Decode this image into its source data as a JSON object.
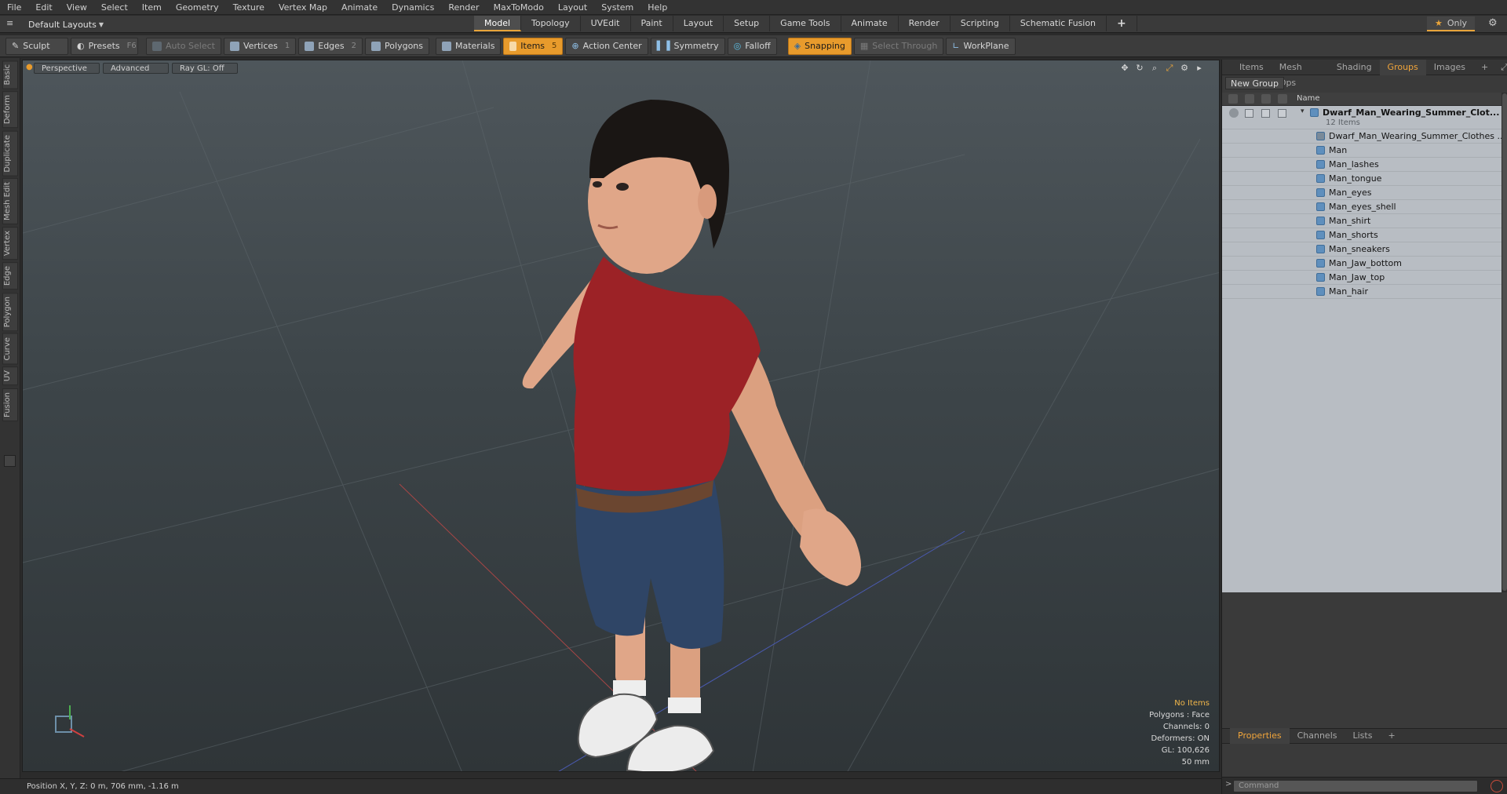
{
  "menu": [
    "File",
    "Edit",
    "View",
    "Select",
    "Item",
    "Geometry",
    "Texture",
    "Vertex Map",
    "Animate",
    "Dynamics",
    "Render",
    "MaxToModo",
    "Layout",
    "System",
    "Help"
  ],
  "layout": {
    "preset_label": "Default Layouts",
    "tabs": [
      "Model",
      "Topology",
      "UVEdit",
      "Paint",
      "Layout",
      "Setup",
      "Game Tools",
      "Animate",
      "Render",
      "Scripting",
      "Schematic Fusion"
    ],
    "active_tab": "Model",
    "add_tab": "+",
    "only_label": "Only"
  },
  "toolbar": {
    "sculpt": "Sculpt",
    "presets": "Presets",
    "presets_key": "F6",
    "auto_select": "Auto Select",
    "vertices": "Vertices",
    "vertices_count": "1",
    "edges": "Edges",
    "edges_count": "2",
    "polygons": "Polygons",
    "materials": "Materials",
    "items": "Items",
    "items_count": "5",
    "action_center": "Action Center",
    "symmetry": "Symmetry",
    "falloff": "Falloff",
    "snapping": "Snapping",
    "select_through": "Select Through",
    "workplane": "WorkPlane"
  },
  "left_tabs": [
    "Basic",
    "Deform",
    "Duplicate",
    "Mesh Edit",
    "Vertex",
    "Edge",
    "Polygon",
    "Curve",
    "UV",
    "Fusion"
  ],
  "viewport": {
    "view_mode": "Perspective",
    "shading": "Advanced",
    "raygl": "Ray GL: Off",
    "hud": [
      "No Items",
      "Polygons : Face",
      "Channels: 0",
      "Deformers: ON",
      "GL: 100,626",
      "50 mm"
    ]
  },
  "status": {
    "position": "Position X, Y, Z:  0 m, 706 mm, -1.16 m"
  },
  "right_panel": {
    "tabs": [
      "Items",
      "Mesh Ops",
      "Shading",
      "Groups",
      "Images",
      "+"
    ],
    "active_tab": "Groups",
    "new_group": "New Group",
    "column_name": "Name",
    "group": {
      "name": "Dwarf_Man_Wearing_Summer_Clot...",
      "count": "12 Items"
    },
    "items": [
      "Dwarf_Man_Wearing_Summer_Clothes ...",
      "Man",
      "Man_lashes",
      "Man_tongue",
      "Man_eyes",
      "Man_eyes_shell",
      "Man_shirt",
      "Man_shorts",
      "Man_sneakers",
      "Man_Jaw_bottom",
      "Man_Jaw_top",
      "Man_hair"
    ],
    "bottom_tabs": [
      "Properties",
      "Channels",
      "Lists",
      "+"
    ],
    "bottom_active": "Properties",
    "command_prompt": ">",
    "command_placeholder": "Command"
  },
  "colors": {
    "accent": "#e89b2c",
    "viewport_top": "#4e565b",
    "viewport_bottom": "#2f3538",
    "shirt": "#9c2226",
    "shorts": "#2f4566",
    "skin": "#e0a688",
    "hair": "#1a1614"
  }
}
